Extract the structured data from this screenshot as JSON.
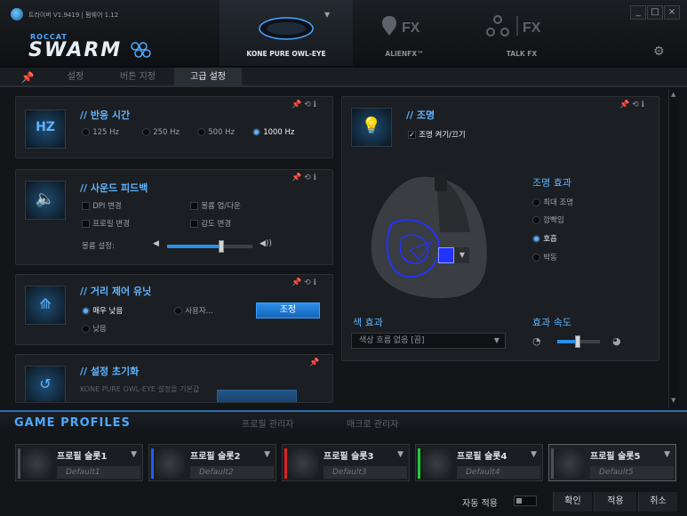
{
  "app": {
    "version": "트라이버 V1.9419 | 펌웨어 1.12",
    "brand_sub": "ROCCAT",
    "brand": "SWARM"
  },
  "top_tabs": [
    {
      "label": "KONE PURE OWL-EYE",
      "active": true
    },
    {
      "label": "ALIENFX™",
      "active": false
    },
    {
      "label": "TALK FX",
      "active": false
    }
  ],
  "window_controls": {
    "minimize": "_",
    "maximize": "□",
    "close": "×"
  },
  "subnav": {
    "items": [
      "설정",
      "버튼 지정",
      "고급 설정"
    ],
    "active_index": 2
  },
  "response_time": {
    "title": "// 반응 시간",
    "options": [
      "125 Hz",
      "250 Hz",
      "500 Hz",
      "1000 Hz"
    ],
    "selected": "1000 Hz"
  },
  "sound_feedback": {
    "title": "// 사운드 피드백",
    "checks": [
      "DPI 변경",
      "볼륨 업/다운",
      "프로필 변경",
      "감도 변경"
    ],
    "volume_label": "볼륨 설정:",
    "volume_level": 0.75
  },
  "distance_unit": {
    "title": "// 거리 제어 유닛",
    "options": [
      "매우 낮음",
      "사용자...",
      "낮음"
    ],
    "selected": "매우 낮음",
    "button": "조정"
  },
  "reset": {
    "title": "// 설정 초기화",
    "desc": "KONE PURE OWL-EYE 설정을 기본값"
  },
  "lighting": {
    "title": "// 조명",
    "toggle_label": "조명 켜기/끄기",
    "toggle_checked": true,
    "effects_title": "조명 효과",
    "effects": [
      "최대 조명",
      "깜빡임",
      "호흡",
      "박동"
    ],
    "effect_selected": "호흡",
    "color_effect_title": "색 효과",
    "color_effect_value": "색상 흐름 없음 [끔]",
    "speed_title": "효과 속도",
    "speed_level": 0.4,
    "accent_color": "#2233ff"
  },
  "profiles": {
    "title": "GAME PROFILES",
    "tabs": [
      "프로필 관리자",
      "매크로 관리자"
    ],
    "slots": [
      {
        "name": "프로필 슬롯1",
        "default": "Default1",
        "color": "#4a5058"
      },
      {
        "name": "프로필 슬롯2",
        "default": "Default2",
        "color": "#1f5cff"
      },
      {
        "name": "프로필 슬롯3",
        "default": "Default3",
        "color": "#e02020"
      },
      {
        "name": "프로필 슬롯4",
        "default": "Default4",
        "color": "#22cc33"
      },
      {
        "name": "프로필 슬롯5",
        "default": "Default5",
        "color": "#4a5058"
      }
    ],
    "active_slot": 4
  },
  "footer": {
    "auto_apply": "자동 적용",
    "ok": "확인",
    "apply": "적용",
    "cancel": "취소"
  }
}
